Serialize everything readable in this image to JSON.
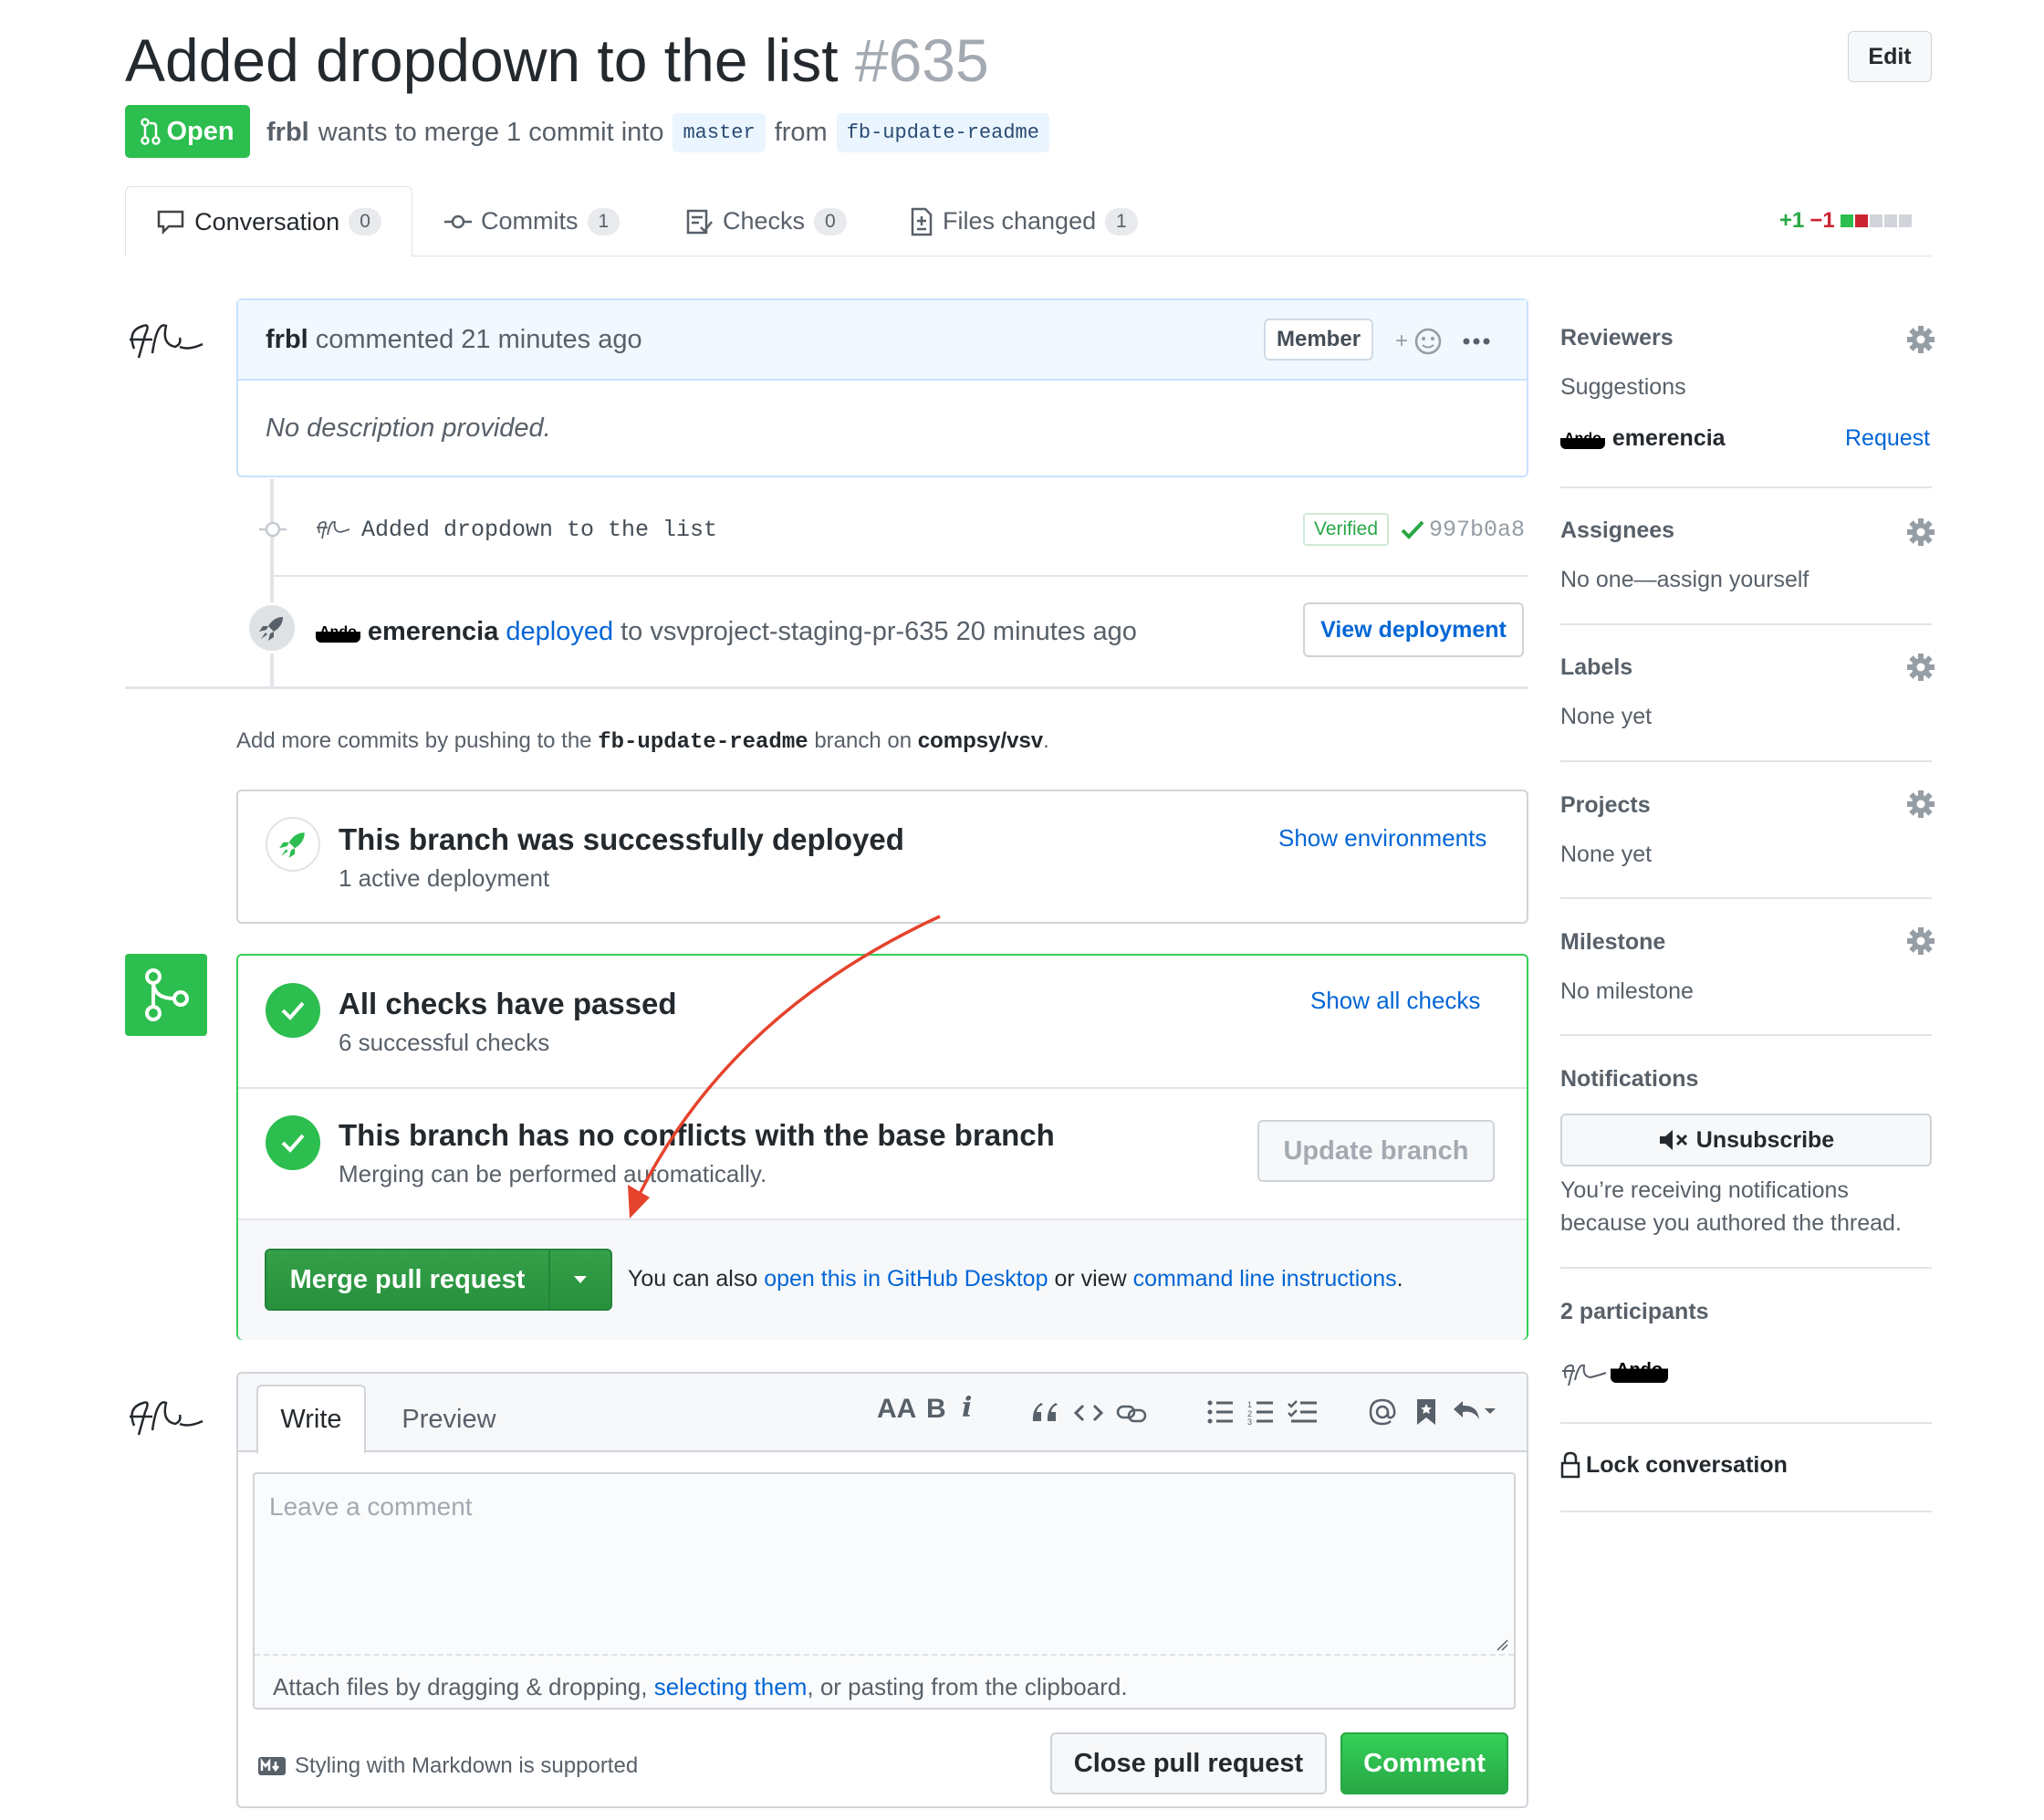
{
  "header": {
    "title": "Added dropdown to the list",
    "number": "#635",
    "edit_label": "Edit",
    "state_label": "Open",
    "author": "frbl",
    "merge_text": "wants to merge 1 commit into",
    "base_branch": "master",
    "from_text": "from",
    "head_branch": "fb-update-readme"
  },
  "tabs": [
    {
      "label": "Conversation",
      "count": "0"
    },
    {
      "label": "Commits",
      "count": "1"
    },
    {
      "label": "Checks",
      "count": "0"
    },
    {
      "label": "Files changed",
      "count": "1"
    }
  ],
  "diffstat": {
    "additions": "+1",
    "deletions": "−1"
  },
  "comment": {
    "author": "frbl",
    "action": "commented 21 minutes ago",
    "role": "Member",
    "body": "No description provided."
  },
  "commit": {
    "message": "Added dropdown to the list",
    "verified": "Verified",
    "sha": "997b0a8"
  },
  "deployment": {
    "badge": "Ando",
    "user": "emerencia",
    "action_link": "deployed",
    "target": "to vsvproject-staging-pr-635 20 minutes ago",
    "button": "View deployment"
  },
  "push_hint": {
    "prefix": "Add more commits by pushing to the",
    "branch": "fb-update-readme",
    "middle": "branch on",
    "repo": "compsy/vsv",
    "suffix": "."
  },
  "deploy_status": {
    "title": "This branch was successfully deployed",
    "subtitle": "1 active deployment",
    "link": "Show environments"
  },
  "checks": {
    "title": "All checks have passed",
    "subtitle": "6 successful checks",
    "link": "Show all checks"
  },
  "conflicts": {
    "title": "This branch has no conflicts with the base branch",
    "subtitle": "Merging can be performed automatically.",
    "button": "Update branch"
  },
  "merge": {
    "button": "Merge pull request",
    "also_text": "You can also",
    "desktop_link": "open this in GitHub Desktop",
    "or_view": "or view",
    "cli_link": "command line instructions",
    "period": "."
  },
  "editor": {
    "tab_write": "Write",
    "tab_preview": "Preview",
    "placeholder": "Leave a comment",
    "attach_prefix": "Attach files by dragging & dropping,",
    "attach_link": "selecting them",
    "attach_suffix": ", or pasting from the clipboard.",
    "markdown_note": "Styling with Markdown is supported",
    "close_button": "Close pull request",
    "comment_button": "Comment",
    "toolbar": {
      "heading": "AA",
      "bold": "B",
      "italic": "i"
    }
  },
  "sidebar": {
    "reviewers": {
      "heading": "Reviewers",
      "suggestions": "Suggestions",
      "user_badge": "Ando",
      "user": "emerencia",
      "request": "Request"
    },
    "assignees": {
      "heading": "Assignees",
      "text": "No one—assign yourself"
    },
    "labels": {
      "heading": "Labels",
      "text": "None yet"
    },
    "projects": {
      "heading": "Projects",
      "text": "None yet"
    },
    "milestone": {
      "heading": "Milestone",
      "text": "No milestone"
    },
    "notifications": {
      "heading": "Notifications",
      "button": "Unsubscribe",
      "line1": "You’re receiving notifications",
      "line2": "because you authored the thread."
    },
    "participants": {
      "heading": "2 participants",
      "badge": "Ando"
    },
    "lock": "Lock conversation"
  },
  "colors": {
    "green": "#2cbe4e",
    "blue": "#0366d6",
    "arrow": "#e5432c"
  }
}
